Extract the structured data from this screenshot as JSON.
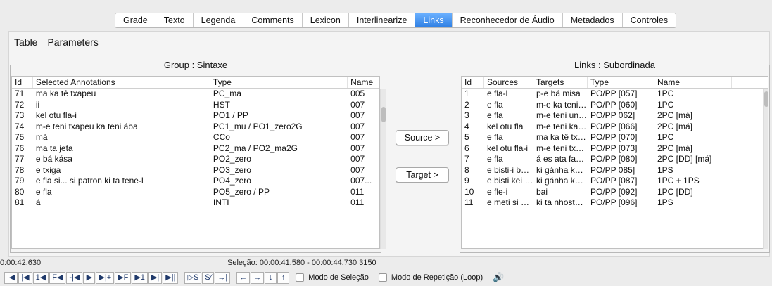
{
  "tabs": [
    "Grade",
    "Texto",
    "Legenda",
    "Comments",
    "Lexicon",
    "Interlinearize",
    "Links",
    "Reconhecedor de Áudio",
    "Metadados",
    "Controles"
  ],
  "active_tab": "Links",
  "menu": [
    "Table",
    "Parameters"
  ],
  "left_group": {
    "title": "Group : Sintaxe",
    "columns": [
      "Id",
      "Selected Annotations",
      "Type",
      "Name"
    ],
    "rows": [
      [
        "71",
        "ma ka tê txapeu",
        "PC_ma",
        "005"
      ],
      [
        "72",
        "ii",
        "HST",
        "007"
      ],
      [
        "73",
        "kel otu fla-i",
        "PO1 / PP",
        "007"
      ],
      [
        "74",
        "m-e teni txapeu ka teni ába",
        "PC1_mu / PO1_zero2G",
        "007"
      ],
      [
        "75",
        "má",
        "CCo",
        "007"
      ],
      [
        "76",
        "ma ta jeta",
        "PC2_ma / PO2_ma2G",
        "007"
      ],
      [
        "77",
        "e bá kása",
        "PO2_zero",
        "007"
      ],
      [
        "78",
        "e txiga",
        "PO3_zero",
        "007"
      ],
      [
        "79",
        "e fla si... si patron ki ta tene-l",
        "PO4_zero",
        "007..."
      ],
      [
        "80",
        "e fla",
        "PO5_zero / PP",
        "011"
      ],
      [
        "81",
        "á",
        "INTI",
        "011"
      ]
    ]
  },
  "buttons": {
    "source": "Source >",
    "target": "Target >"
  },
  "right_group": {
    "title": "Links : Subordinada",
    "columns": [
      "Id",
      "Sources",
      "Targets",
      "Type",
      "Name"
    ],
    "rows": [
      [
        "1",
        "e fla-l",
        "p-e bá misa",
        "PO/PP [057]",
        "1PC"
      ],
      [
        "2",
        "e fla",
        "m-e ka teni ropa",
        "PO/PP [060]",
        "1PC"
      ],
      [
        "3",
        "e fla",
        "m-e teni un kái...",
        "PO/PP 062]",
        "2PC [má]"
      ],
      [
        "4",
        "kel otu fla",
        "m-e teni kamis...",
        "PO/PP [066]",
        "2PC [má]"
      ],
      [
        "5",
        "e fla",
        "ma ka tê txapeu",
        "PO/PP [070]",
        "1PC"
      ],
      [
        "6",
        "kel otu fla-i",
        "m-e teni txape...",
        "PO/PP [073]",
        "2PC [má]"
      ],
      [
        "7",
        "e fla",
        "á es ata fasi tró...",
        "PO/PP [080]",
        "2PC [DD] [má]"
      ],
      [
        "8",
        "e bisti-i ben bis...",
        "ki gánha kes ot...",
        "PO/PP 085]",
        "1PS"
      ],
      [
        "9",
        "e bisti kei ka pr...",
        "ki gánha kes ot...",
        "PO/PP [087]",
        "1PC + 1PS"
      ],
      [
        "10",
        "e fle-i",
        "bai",
        "PO/PP [092]",
        "1PC [DD]"
      ],
      [
        "11",
        "e meti si mula n...",
        "ki ta nhosta din...",
        "PO/PP [096]",
        "1PS"
      ]
    ]
  },
  "status": {
    "time": "0:00:42.630",
    "selection": "Seleção: 00:00:41.580 - 00:00:44.730  3150"
  },
  "controls": {
    "transport": [
      "|◀",
      "|◀",
      "1◀",
      "F◀",
      "-|◀",
      "▶",
      "▶|+",
      "▶F",
      "▶1",
      "▶|",
      "▶||"
    ],
    "selection": [
      "▷S",
      "S⁄",
      "→|"
    ],
    "arrows": [
      "←",
      "→",
      "↓",
      "↑"
    ],
    "selection_mode": "Modo de Seleção",
    "loop_mode": "Modo de Repetição (Loop)"
  },
  "colors": {
    "accent": "#2f7fe3"
  }
}
